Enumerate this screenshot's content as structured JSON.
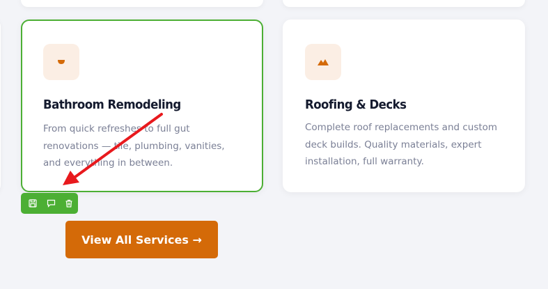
{
  "colors": {
    "page_bg": "#f3f4f8",
    "card_bg": "#ffffff",
    "selected_border": "#4caf34",
    "icon_bg": "#fbeee4",
    "icon_fg": "#d46a08",
    "title": "#141a2e",
    "description": "#7a7f95",
    "cta_bg": "#d46a08",
    "annotation_arrow": "#e8191d"
  },
  "cards": [
    {
      "icon": "bathroom-icon",
      "title": "Bathroom Remodeling",
      "description_lines": [
        "From quick refreshes to full gut",
        "renovations — tile, plumbing, vanities,",
        "and everything in between."
      ],
      "selected": true
    },
    {
      "icon": "roof-icon",
      "title": "Roofing & Decks",
      "description_lines": [
        "Complete roof replacements and custom",
        "deck builds. Quality materials, expert",
        "installation, full warranty."
      ],
      "selected": false
    }
  ],
  "editor_toolbar": {
    "actions": [
      "save-icon",
      "comment-icon",
      "delete-icon"
    ]
  },
  "cta": {
    "label": "View All Services →"
  }
}
